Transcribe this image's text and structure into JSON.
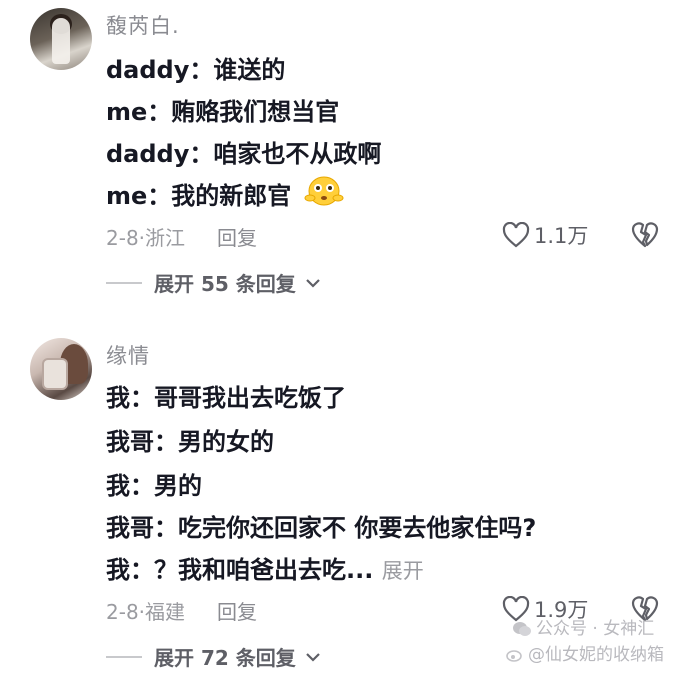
{
  "comments": [
    {
      "username": "馥芮白.",
      "lines": [
        "daddy：谁送的",
        "me：贿赂我们想当官",
        "daddy：咱家也不从政啊",
        "me：我的新郎官"
      ],
      "date": "2-8",
      "location": "浙江",
      "reply_label": "回复",
      "likes": "1.1万",
      "expand_replies": "展开 55 条回复"
    },
    {
      "username": "缘情",
      "lines": [
        "我：哥哥我出去吃饭了",
        "我哥：男的女的",
        "我：男的",
        "我哥：吃完你还回家不 你要去他家住吗?",
        "我：？我和咱爸出去吃..."
      ],
      "inline_expand": "展开",
      "date": "2-8",
      "location": "福建",
      "reply_label": "回复",
      "likes": "1.9万",
      "expand_replies": "展开 72 条回复"
    }
  ],
  "watermark": {
    "account": "公众号 · 女神汇",
    "handle": "@仙女妮的收纳箱"
  },
  "icons": {
    "like": "heart-outline-icon",
    "dislike": "broken-heart-icon",
    "expand": "chevron-down-icon",
    "emoji": "flushed-face-emoji",
    "wechat": "wechat-logo-icon",
    "weibo": "weibo-logo-icon"
  },
  "colors": {
    "text": "#161823",
    "secondary": "#9a9ba0"
  }
}
